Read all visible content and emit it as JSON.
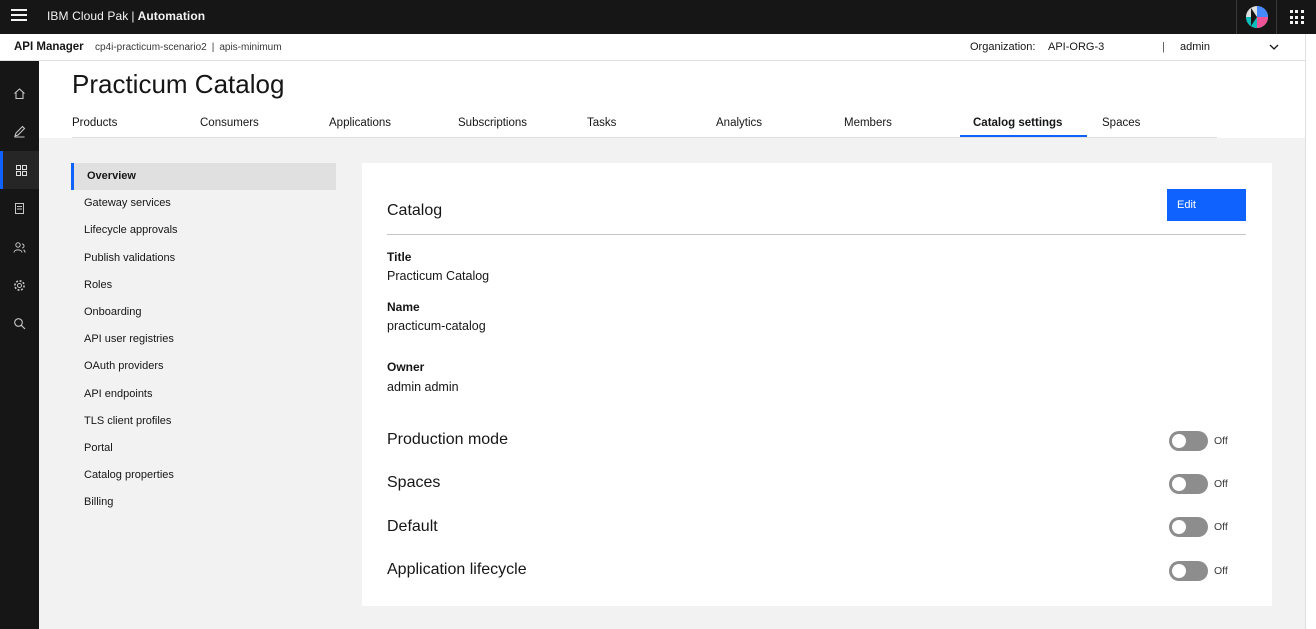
{
  "header": {
    "product": "IBM Cloud Pak",
    "product_suffix": "Automation",
    "separator": "|"
  },
  "subbar": {
    "app_name": "API Manager",
    "crumbs": [
      "cp4i-practicum-scenario2",
      "apis-minimum"
    ],
    "crumb_sep": "|",
    "org_label": "Organization:",
    "org_value": "API-ORG-3",
    "pipe": "|",
    "user": "admin"
  },
  "page": {
    "title": "Practicum Catalog"
  },
  "tabs": [
    {
      "label": "Products"
    },
    {
      "label": "Consumers"
    },
    {
      "label": "Applications"
    },
    {
      "label": "Subscriptions"
    },
    {
      "label": "Tasks"
    },
    {
      "label": "Analytics"
    },
    {
      "label": "Members"
    },
    {
      "label": "Catalog settings",
      "active": true
    },
    {
      "label": "Spaces"
    }
  ],
  "sidenav": [
    {
      "label": "Overview",
      "active": true
    },
    {
      "label": "Gateway services"
    },
    {
      "label": "Lifecycle approvals"
    },
    {
      "label": "Publish validations"
    },
    {
      "label": "Roles"
    },
    {
      "label": "Onboarding"
    },
    {
      "label": "API user registries"
    },
    {
      "label": "OAuth providers"
    },
    {
      "label": "API endpoints"
    },
    {
      "label": "TLS client profiles"
    },
    {
      "label": "Portal"
    },
    {
      "label": "Catalog properties"
    },
    {
      "label": "Billing"
    }
  ],
  "card": {
    "title": "Catalog",
    "edit_label": "Edit",
    "fields": [
      {
        "label": "Title",
        "value": "Practicum Catalog"
      },
      {
        "label": "Name",
        "value": "practicum-catalog"
      },
      {
        "label": "Owner",
        "value": "admin admin"
      }
    ],
    "toggles": [
      {
        "label": "Production mode",
        "state": "Off"
      },
      {
        "label": "Spaces",
        "state": "Off"
      },
      {
        "label": "Default",
        "state": "Off"
      },
      {
        "label": "Application lifecycle",
        "state": "Off"
      }
    ]
  },
  "rail_icons": [
    "home-icon",
    "edit-icon",
    "manage-icon",
    "document-icon",
    "members-icon",
    "settings-icon",
    "search-icon"
  ],
  "colors": {
    "accent": "#0f62fe",
    "header_bg": "#161616",
    "page_bg": "#f2f2f2",
    "toggle_off": "#8d8d8d"
  }
}
